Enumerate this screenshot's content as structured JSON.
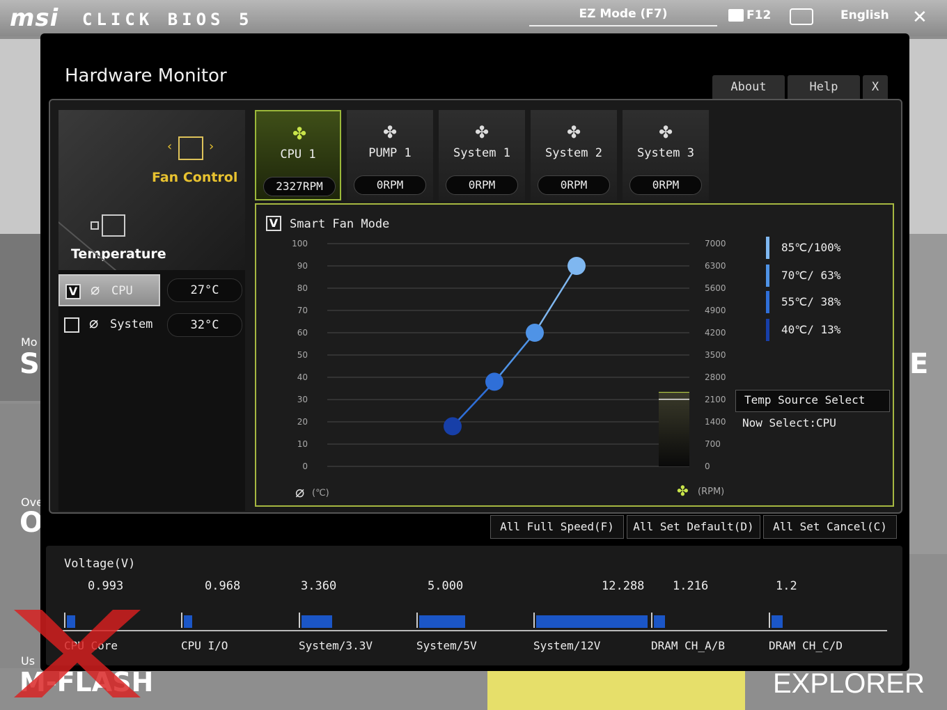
{
  "topbar": {
    "brand": "msi",
    "product": "CLICK BIOS 5",
    "ez_mode": "EZ Mode (F7)",
    "f12": "F12",
    "language": "English",
    "close": "✕"
  },
  "background": {
    "left_labels": [
      "Mo",
      "SI",
      "Ove",
      "O",
      "Us",
      "M-FLASH"
    ],
    "right_letter": "E",
    "explorer": "EXPLORER"
  },
  "modal": {
    "title": "Hardware Monitor",
    "about": "About",
    "help": "Help",
    "close": "X"
  },
  "sidebar": {
    "fan_control": "Fan Control",
    "temperature": "Temperature",
    "sensors": [
      {
        "name": "CPU",
        "value": "27°C",
        "checked": true
      },
      {
        "name": "System",
        "value": "32°C",
        "checked": false
      }
    ]
  },
  "fans": [
    {
      "name": "CPU 1",
      "rpm": "2327RPM",
      "active": true
    },
    {
      "name": "PUMP 1",
      "rpm": "0RPM",
      "active": false
    },
    {
      "name": "System 1",
      "rpm": "0RPM",
      "active": false
    },
    {
      "name": "System 2",
      "rpm": "0RPM",
      "active": false
    },
    {
      "name": "System 3",
      "rpm": "0RPM",
      "active": false
    }
  ],
  "smart_fan": {
    "label": "Smart Fan Mode",
    "checked": true,
    "left_axis": [
      "100",
      "90",
      "80",
      "70",
      "60",
      "50",
      "40",
      "30",
      "20",
      "10",
      "0"
    ],
    "right_axis": [
      "7000",
      "6300",
      "5600",
      "4900",
      "4200",
      "3500",
      "2800",
      "2100",
      "1400",
      "700",
      "0"
    ],
    "left_unit": "(℃)",
    "right_unit": "(RPM)",
    "points": [
      {
        "x_pct": 0.0,
        "y": 18
      },
      {
        "x_pct": 0.0,
        "y": 38
      },
      {
        "x_pct": 0.0,
        "y": 60
      },
      {
        "x_pct": 0.0,
        "y": 90
      }
    ],
    "legend": [
      "85℃/100%",
      "70℃/ 63%",
      "55℃/ 38%",
      "40℃/ 13%"
    ],
    "legend_colors": [
      "#7fb7f0",
      "#4f93e6",
      "#2f6fd8",
      "#173fa8"
    ],
    "temp_source_btn": "Temp Source Select",
    "now_select": "Now Select:CPU",
    "current_rpm": 2327
  },
  "actions": {
    "full_speed": "All Full Speed(F)",
    "set_default": "All Set Default(D)",
    "set_cancel": "All Set Cancel(C)"
  },
  "voltage": {
    "title": "Voltage(V)",
    "items": [
      {
        "label": "CPU Core",
        "value": "0.993",
        "level": 0.06
      },
      {
        "label": "CPU I/O",
        "value": "0.968",
        "level": 0.06
      },
      {
        "label": "System/3.3V",
        "value": "3.360",
        "level": 0.22
      },
      {
        "label": "System/5V",
        "value": "5.000",
        "level": 0.33
      },
      {
        "label": "System/12V",
        "value": "12.288",
        "level": 0.8
      },
      {
        "label": "DRAM CH_A/B",
        "value": "1.216",
        "level": 0.08
      },
      {
        "label": "DRAM CH_C/D",
        "value": "1.2",
        "level": 0.08
      }
    ]
  },
  "colors": {
    "accent_green": "#a6b841",
    "fan_label": "#e8c230",
    "bar_blue": "#1b56c7",
    "watermark": "#d92020"
  }
}
